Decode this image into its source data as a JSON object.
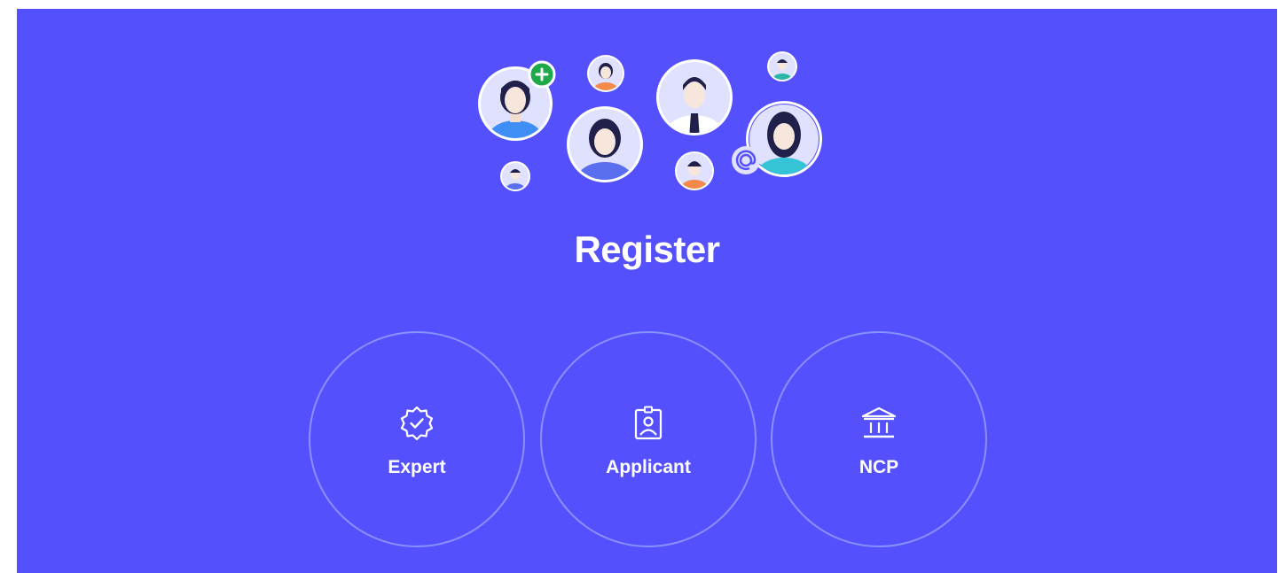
{
  "page": {
    "title": "Register",
    "background_color": "#5550fe",
    "accent_colors": {
      "badge_green": "#1fa94a",
      "circle_outline": "#96aaff"
    }
  },
  "options": [
    {
      "label": "Expert",
      "icon": "verified-badge-icon"
    },
    {
      "label": "Applicant",
      "icon": "id-badge-icon"
    },
    {
      "label": "NCP",
      "icon": "institution-icon"
    }
  ],
  "illustration": {
    "avatars": [
      "person-avatar-icon",
      "person-avatar-icon",
      "person-avatar-icon",
      "person-avatar-icon",
      "person-avatar-icon",
      "person-avatar-icon",
      "person-avatar-icon",
      "person-avatar-icon",
      "person-avatar-icon"
    ],
    "badges": [
      "plus-icon",
      "at-sign-icon"
    ]
  }
}
